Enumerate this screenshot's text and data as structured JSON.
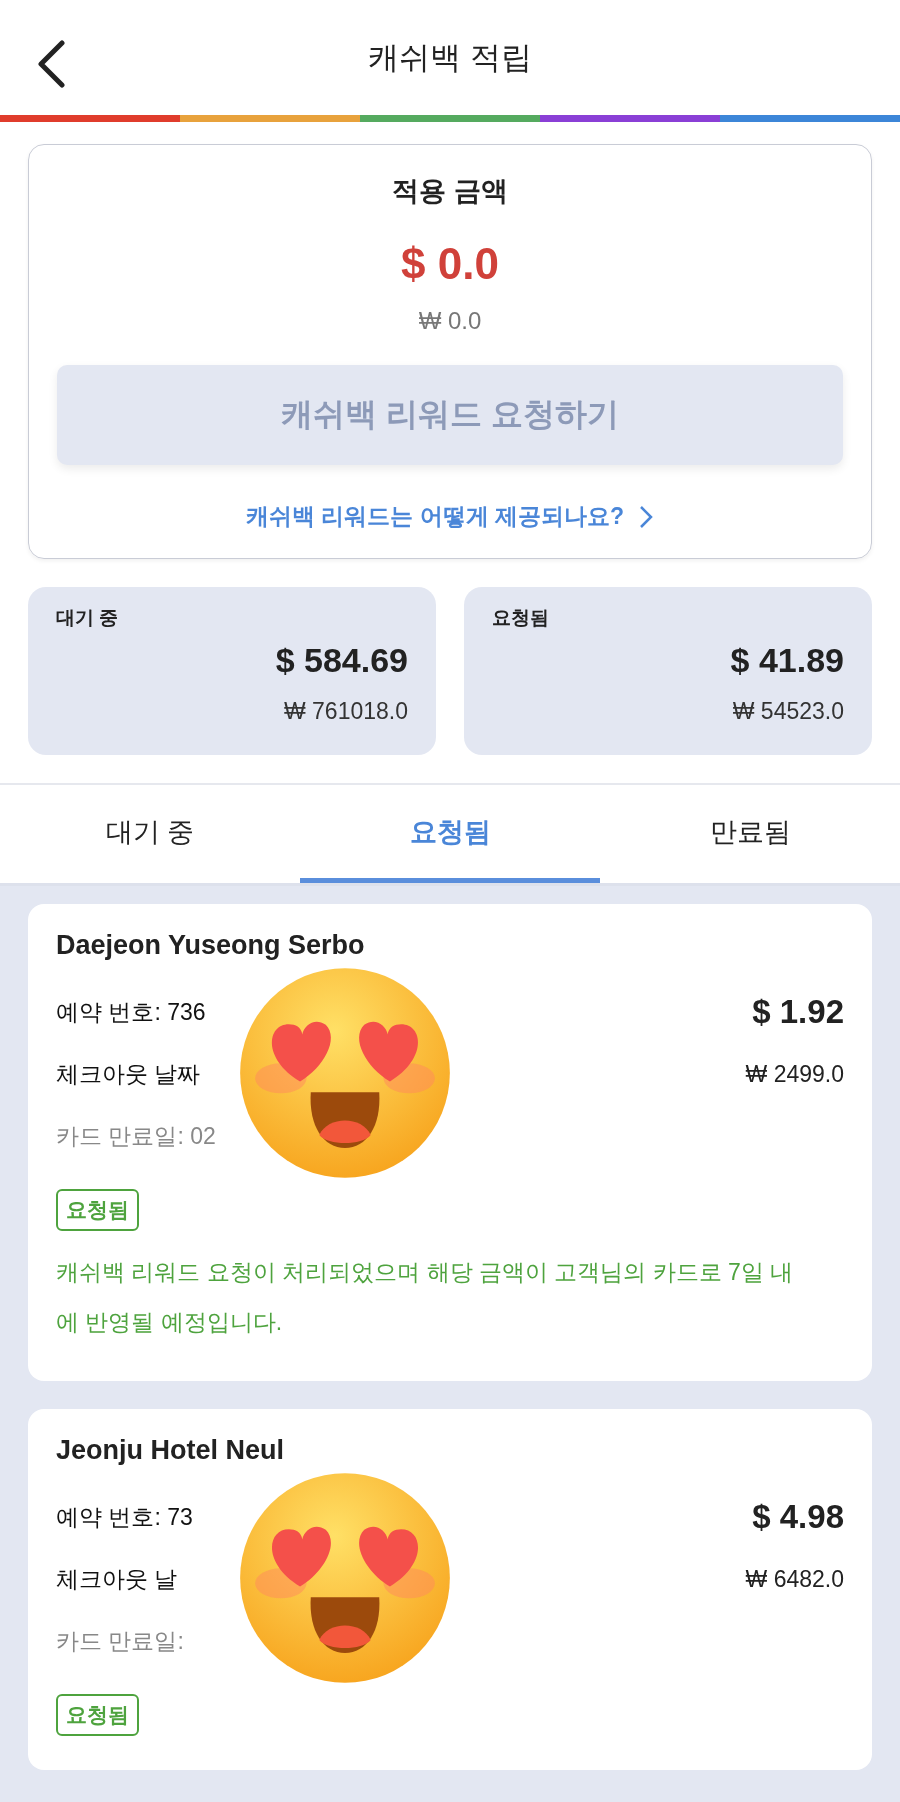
{
  "header": {
    "title": "캐쉬백 적립"
  },
  "summary": {
    "title": "적용 금액",
    "usd": "$ 0.0",
    "krw": "₩ 0.0",
    "button": {
      "label": "캐쉬백 리워드 요청하기",
      "disabled": true
    },
    "link": "캐쉬백 리워드는 어떻게 제공되나요?"
  },
  "totals": [
    {
      "label": "대기 중",
      "usd": "$ 584.69",
      "krw": "₩ 761018.0"
    },
    {
      "label": "요청됨",
      "usd": "$ 41.89",
      "krw": "₩ 54523.0"
    }
  ],
  "tabs": [
    {
      "label": "대기 중",
      "selected": false
    },
    {
      "label": "요청됨",
      "selected": true
    },
    {
      "label": "만료됨",
      "selected": false
    }
  ],
  "bookings": [
    {
      "name": "Daejeon Yuseong Serbo",
      "reservation": "예약 번호: 736",
      "checkout": "체크아웃 날짜",
      "card_expiry": "카드 만료일: 02",
      "usd": "$ 1.92",
      "krw": "₩ 2499.0",
      "status": "요청됨",
      "message": "캐쉬백 리워드 요청이 처리되었으며 해당 금액이 고객님의 카드로 7일 내에 반영될 예정입니다.",
      "sticker": true
    },
    {
      "name": "Jeonju Hotel Neul",
      "reservation": "예약 번호: 73",
      "checkout": "체크아웃 날",
      "card_expiry": "카드 만료일:",
      "usd": "$ 4.98",
      "krw": "₩ 6482.0",
      "status": "요청됨",
      "sticker": true
    }
  ]
}
